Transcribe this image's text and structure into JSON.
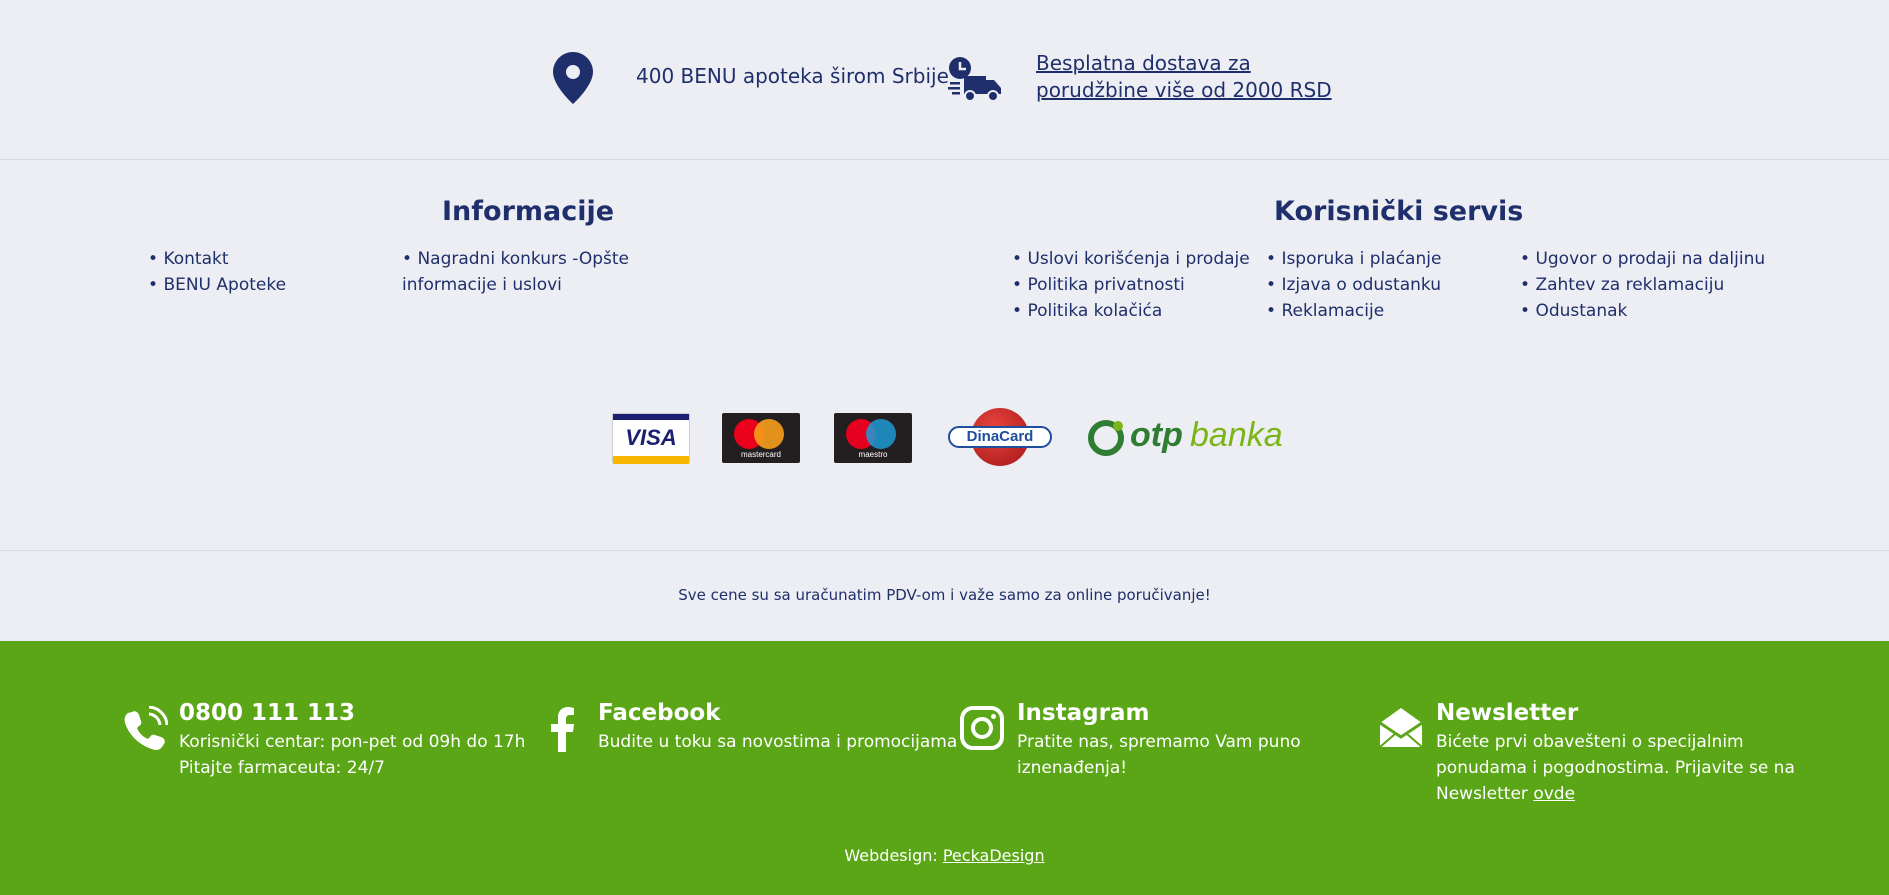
{
  "top": {
    "stores_text": "400 BENU apoteka širom Srbije",
    "shipping_line1": "Besplatna dostava za",
    "shipping_line2": "porudžbine više od 2000 RSD"
  },
  "info": {
    "title": "Informacije",
    "col1": [
      "Kontakt",
      "BENU Apoteke"
    ],
    "col2_line1": "Nagradni konkurs -Opšte",
    "col2_line2": "informacije i uslovi"
  },
  "service": {
    "title": "Korisnički servis",
    "col1": [
      "Uslovi korišćenja i prodaje",
      "Politika privatnosti",
      "Politika kolačića"
    ],
    "col2": [
      "Isporuka i plaćanje",
      "Izjava o odustanku",
      "Reklamacije"
    ],
    "col3": [
      "Ugovor o prodaji na daljinu",
      "Zahtev za reklamaciju",
      "Odustanak"
    ]
  },
  "payments": {
    "visa": "VISA",
    "mastercard": "mastercard",
    "maestro": "maestro",
    "dinacard": "DinaCard",
    "otp_a": "otp",
    "otp_b": "banka"
  },
  "note": "Sve cene su sa uračunatim PDV-om i važe samo za online poručivanje!",
  "footer": {
    "phone": {
      "title": "0800 111 113",
      "line1": "Korisnički centar: pon-pet od 09h do 17h",
      "line2": "Pitajte farmaceuta: 24/7"
    },
    "facebook": {
      "title": "Facebook",
      "line1": "Budite u toku sa novostima i promocijama"
    },
    "instagram": {
      "title": "Instagram",
      "line1": "Pratite nas, spremamo Vam puno",
      "line2": "iznenađenja!"
    },
    "newsletter": {
      "title": "Newsletter",
      "line1": "Bićete prvi obavešteni o specijalnim",
      "line2": "ponudama i pogodnostima. Prijavite se na",
      "line3": "Newsletter ",
      "link": "ovde"
    },
    "credit_label": "Webdesign: ",
    "credit_link": "PeckaDesign"
  },
  "colors": {
    "navy": "#1f2f6b",
    "green": "#5aa616",
    "bg": "#edeef3"
  }
}
